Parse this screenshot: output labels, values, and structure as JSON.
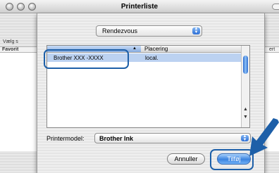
{
  "window": {
    "title": "Printerliste"
  },
  "background": {
    "left_label_partial": "Vælg s",
    "favorit_label": "Favorit",
    "right_partial": "ert"
  },
  "dialog": {
    "connection_popup": {
      "selected": "Rendezvous",
      "arrows_icon": "up-down-arrows-icon"
    },
    "printer_list": {
      "columns": [
        "",
        "Placering"
      ],
      "rows": [
        {
          "name": "Brother XXX -XXXX",
          "location": "local."
        }
      ]
    },
    "printer_model": {
      "label": "Printermodel:",
      "selected": "Brother Ink"
    },
    "buttons": {
      "cancel": "Annuller",
      "add": "Tilføj"
    }
  },
  "colors": {
    "annotation": "#1d5fa8",
    "selection": "#bcd2f1",
    "aqua_blue": "#3c84e0"
  }
}
